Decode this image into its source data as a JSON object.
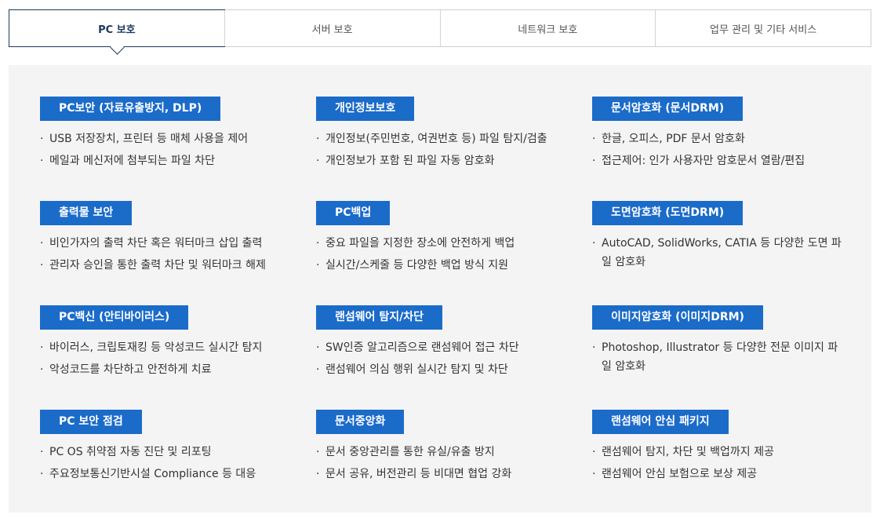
{
  "tabs": [
    {
      "label": "PC 보호",
      "active": true
    },
    {
      "label": "서버 보호",
      "active": false
    },
    {
      "label": "네트워크 보호",
      "active": false
    },
    {
      "label": "업무 관리 및 기타 서비스",
      "active": false
    }
  ],
  "accent_color": "#1b6bc9",
  "items": [
    {
      "title": "PC보안 (자료유출방지, DLP)",
      "bullets": [
        "USB 저장장치, 프린터 등 매체 사용을 제어",
        "메일과 메신저에 첨부되는 파일 차단"
      ]
    },
    {
      "title": "개인정보보호",
      "bullets": [
        "개인정보(주민번호, 여권번호 등) 파일 탐지/검출",
        "개인정보가 포함 된 파일 자동 암호화"
      ]
    },
    {
      "title": "문서암호화 (문서DRM)",
      "bullets": [
        "한글, 오피스, PDF 문서 암호화",
        "접근제어: 인가 사용자만 암호문서 열람/편집"
      ]
    },
    {
      "title": "출력물 보안",
      "bullets": [
        "비인가자의 출력 차단 혹은 워터마크 삽입 출력",
        "관리자 승인을 통한 출력 차단 및 워터마크 해제"
      ]
    },
    {
      "title": "PC백업",
      "bullets": [
        "중요 파일을 지정한 장소에 안전하게 백업",
        "실시간/스케줄 등 다양한 백업 방식 지원"
      ]
    },
    {
      "title": "도면암호화 (도면DRM)",
      "bullets": [
        "AutoCAD, SolidWorks, CATIA 등 다양한 도면 파일 암호화"
      ]
    },
    {
      "title": "PC백신 (안티바이러스)",
      "bullets": [
        "바이러스, 크립토재킹 등 악성코드 실시간 탐지",
        "악성코드를 차단하고 안전하게 치료"
      ]
    },
    {
      "title": "랜섬웨어 탐지/차단",
      "bullets": [
        "SW인증 알고리즘으로 랜섬웨어 접근 차단",
        "랜섬웨어 의심 행위 실시간 탐지 및 차단"
      ]
    },
    {
      "title": "이미지암호화 (이미지DRM)",
      "bullets": [
        "Photoshop, Illustrator 등 다양한 전문 이미지 파일 암호화"
      ]
    },
    {
      "title": "PC 보안 점검",
      "bullets": [
        "PC OS 취약점 자동 진단 및 리포팅",
        "주요정보통신기반시설 Compliance 등 대응"
      ]
    },
    {
      "title": "문서중앙화",
      "bullets": [
        "문서 중앙관리를 통한 유실/유출 방지",
        "문서 공유, 버전관리 등 비대면 협업 강화"
      ]
    },
    {
      "title": "랜섬웨어 안심 패키지",
      "bullets": [
        "랜섬웨어 탐지, 차단 및 백업까지 제공",
        "랜섬웨어 안심 보험으로 보상 제공"
      ]
    }
  ]
}
